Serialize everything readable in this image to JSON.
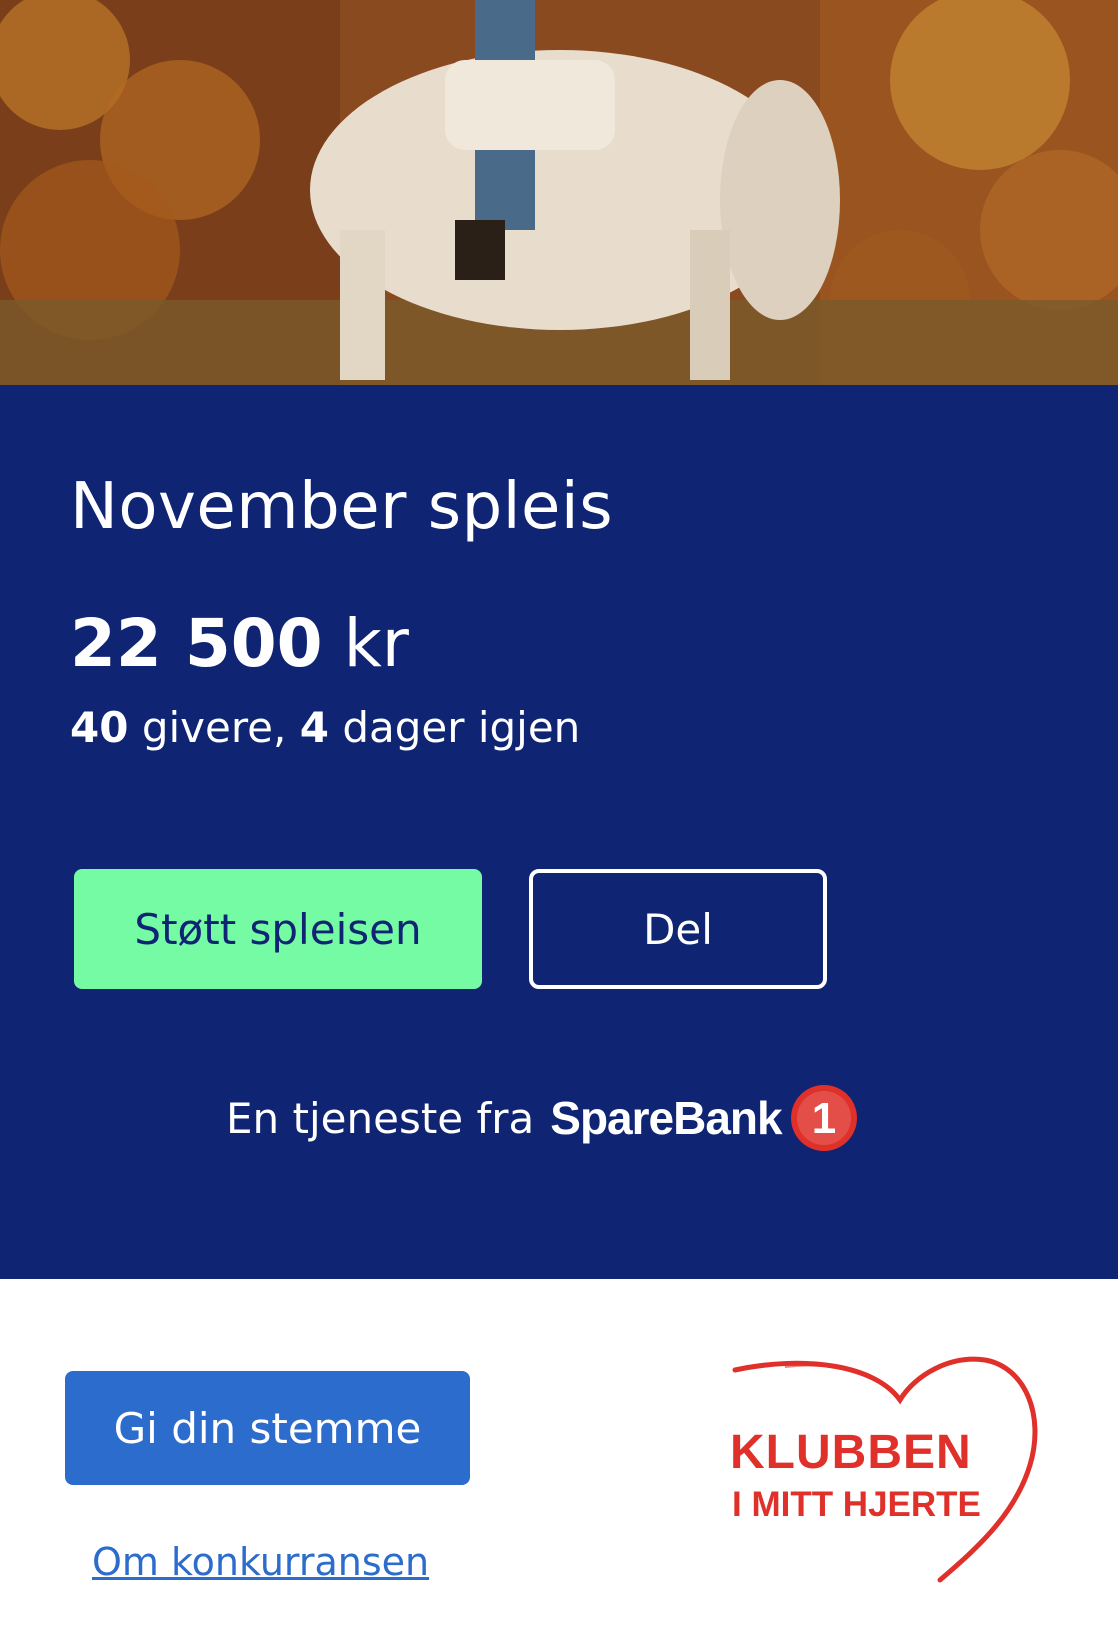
{
  "hero": {
    "image": "autumn-forest-horse-rider-photo"
  },
  "campaign": {
    "title": "November spleis",
    "amount_value": "22 500",
    "amount_unit": "kr",
    "givers_count": "40",
    "givers_text": "givere,",
    "days_count": "4",
    "days_text": "dager igjen"
  },
  "actions": {
    "support_label": "Støtt spleisen",
    "share_label": "Del"
  },
  "service": {
    "prefix": "En tjeneste fra",
    "brand": "SpareBank",
    "brand_badge": "1"
  },
  "footer": {
    "vote_label": "Gi din stemme",
    "about_link": "Om konkurransen",
    "club_logo_line1": "KLUBBEN",
    "club_logo_line2": "I MITT HJERTE"
  },
  "colors": {
    "panel": "#0f2473",
    "support_button": "#74fba4",
    "vote_button": "#2c6ccc",
    "link": "#2c6ccc",
    "brand_red": "#e0302a"
  }
}
